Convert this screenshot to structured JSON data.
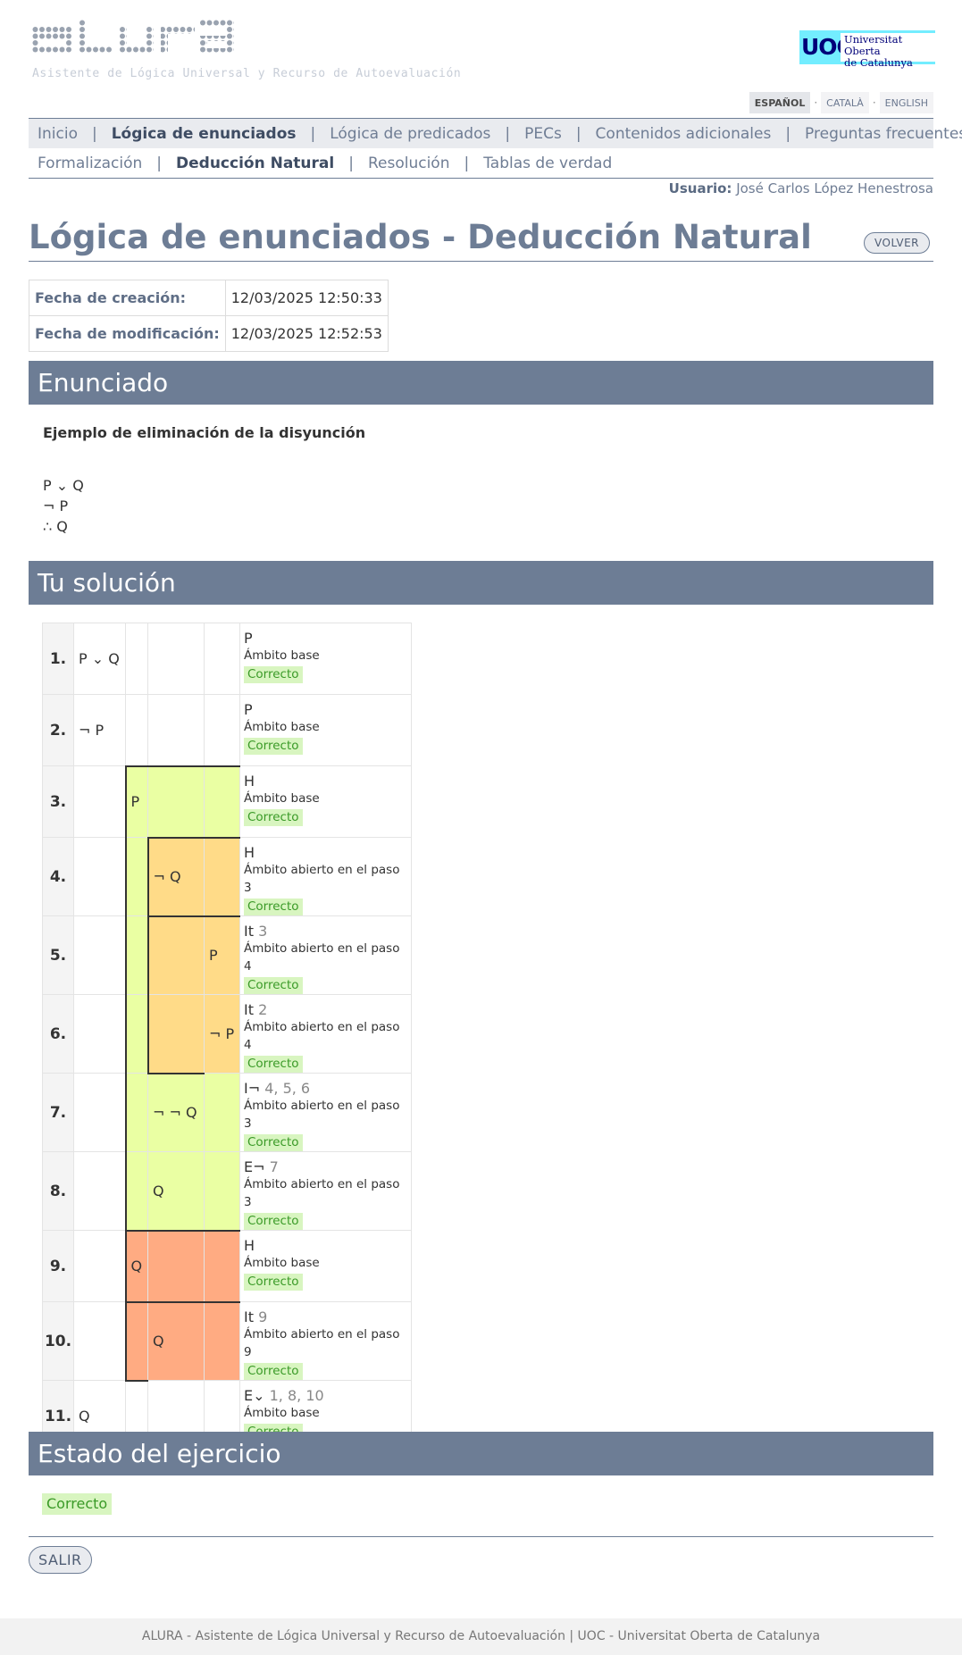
{
  "logo": {
    "text": "ALURA",
    "subtitle": "Asistente de Lógica Universal y Recurso de Autoevaluación"
  },
  "uoc": {
    "mark": "UOC",
    "line1": "Universitat Oberta",
    "line2": "de Catalunya"
  },
  "languages": [
    "ESPAÑOL",
    "CATALÀ",
    "ENGLISH"
  ],
  "nav_main": [
    "Inicio",
    "Lógica de enunciados",
    "Lógica de predicados",
    "PECs",
    "Contenidos adicionales",
    "Preguntas frecuentes"
  ],
  "nav_sub": [
    "Formalización",
    "Deducción Natural",
    "Resolución",
    "Tablas de verdad"
  ],
  "user": {
    "label": "Usuario:",
    "name": "José Carlos López Henestrosa"
  },
  "page_title": "Lógica de enunciados - Deducción Natural",
  "volver_label": "VOLVER",
  "dates": {
    "creacion_label": "Fecha de creación:",
    "creacion_value": "12/03/2025 12:50:33",
    "modificacion_label": "Fecha de modificación:",
    "modificacion_value": "12/03/2025 12:52:53"
  },
  "sections": {
    "enunciado": "Enunciado",
    "solucion": "Tu solución",
    "estado": "Estado del ejercicio"
  },
  "enunciado": {
    "title": "Ejemplo de eliminación de la disyunción",
    "formulas": [
      "P ⌄ Q",
      "¬ P",
      "∴ Q"
    ]
  },
  "proof_steps": [
    {
      "n": "1.",
      "formula": "P ⌄ Q",
      "rule": "P",
      "refs": "",
      "scope": "Ámbito base",
      "status": "Correcto"
    },
    {
      "n": "2.",
      "formula": "¬ P",
      "rule": "P",
      "refs": "",
      "scope": "Ámbito base",
      "status": "Correcto"
    },
    {
      "n": "3.",
      "formula": "P",
      "rule": "H",
      "refs": "",
      "scope": "Ámbito base",
      "status": "Correcto"
    },
    {
      "n": "4.",
      "formula": "¬ Q",
      "rule": "H",
      "refs": "",
      "scope": "Ámbito abierto en el paso 3",
      "status": "Correcto"
    },
    {
      "n": "5.",
      "formula": "P",
      "rule": "It",
      "refs": "3",
      "scope": "Ámbito abierto en el paso 4",
      "status": "Correcto"
    },
    {
      "n": "6.",
      "formula": "¬ P",
      "rule": "It",
      "refs": "2",
      "scope": "Ámbito abierto en el paso 4",
      "status": "Correcto"
    },
    {
      "n": "7.",
      "formula": "¬ ¬ Q",
      "rule": "I¬",
      "refs": "4, 5, 6",
      "scope": "Ámbito abierto en el paso 3",
      "status": "Correcto"
    },
    {
      "n": "8.",
      "formula": "Q",
      "rule": "E¬",
      "refs": "7",
      "scope": "Ámbito abierto en el paso 3",
      "status": "Correcto"
    },
    {
      "n": "9.",
      "formula": "Q",
      "rule": "H",
      "refs": "",
      "scope": "Ámbito base",
      "status": "Correcto"
    },
    {
      "n": "10.",
      "formula": "Q",
      "rule": "It",
      "refs": "9",
      "scope": "Ámbito abierto en el paso 9",
      "status": "Correcto"
    },
    {
      "n": "11.",
      "formula": "Q",
      "rule": "E⌄",
      "refs": "1, 8, 10",
      "scope": "Ámbito base",
      "status": "Correcto"
    }
  ],
  "colors": {
    "scope1": "#eaffa3",
    "scope2": "#ffdb88",
    "scope3": "#ffab82",
    "header": "#6d7d95"
  },
  "estado": "Correcto",
  "salir_label": "SALIR",
  "footer": "ALURA - Asistente de Lógica Universal y Recurso de Autoevaluación | UOC - Universitat Oberta de Catalunya"
}
